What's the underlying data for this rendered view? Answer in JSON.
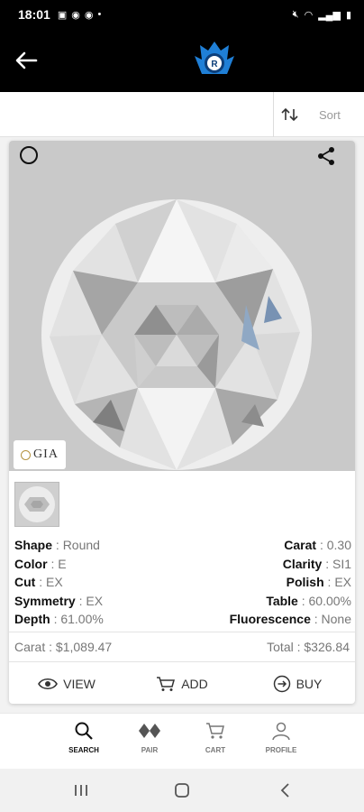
{
  "status_bar": {
    "time": "18:01",
    "left_icons": [
      "image-icon",
      "whatsapp-icon",
      "whatsapp-icon",
      "dot-icon"
    ],
    "right_icons": [
      "mute-icon",
      "wifi-icon",
      "signal-icon",
      "battery-icon"
    ]
  },
  "header": {
    "logo_letter": "R",
    "logo_color": "#1f7fd6"
  },
  "toolbar": {
    "sort_label": "Sort"
  },
  "card": {
    "certificate_label": "GIA",
    "specs_left": [
      {
        "label": "Shape",
        "value": "Round"
      },
      {
        "label": "Color",
        "value": "E"
      },
      {
        "label": "Cut",
        "value": "EX"
      },
      {
        "label": "Symmetry",
        "value": "EX"
      },
      {
        "label": "Depth",
        "value": "61.00%"
      }
    ],
    "specs_right": [
      {
        "label": "Carat",
        "value": "0.30"
      },
      {
        "label": "Clarity",
        "value": "SI1"
      },
      {
        "label": "Polish",
        "value": "EX"
      },
      {
        "label": "Table",
        "value": "60.00%"
      },
      {
        "label": "Fluorescence",
        "value": "None"
      }
    ],
    "separator": ":",
    "price_per_carat": "Carat : $1,089.47",
    "total_price": "Total : $326.84",
    "actions": {
      "view": "VIEW",
      "add": "ADD",
      "buy": "BUY"
    }
  },
  "bottom_nav": {
    "items": [
      {
        "label": "SEARCH",
        "icon": "search-icon",
        "active": true
      },
      {
        "label": "PAIR",
        "icon": "pair-diamonds-icon",
        "active": false
      },
      {
        "label": "CART",
        "icon": "cart-icon",
        "active": false
      },
      {
        "label": "PROFILE",
        "icon": "profile-icon",
        "active": false
      }
    ]
  }
}
